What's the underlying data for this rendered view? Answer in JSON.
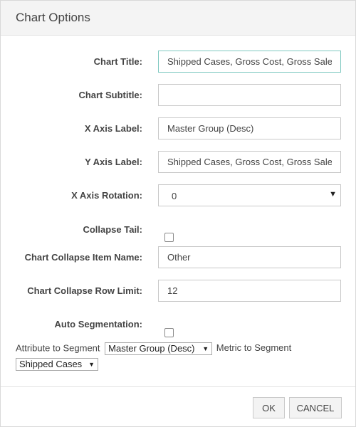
{
  "dialog": {
    "title": "Chart Options"
  },
  "fields": {
    "chart_title": {
      "label": "Chart Title:",
      "value": "Shipped Cases, Gross Cost, Gross Sales"
    },
    "chart_subtitle": {
      "label": "Chart Subtitle:",
      "value": ""
    },
    "x_axis_label": {
      "label": "X Axis Label:",
      "value": "Master Group (Desc)"
    },
    "y_axis_label": {
      "label": "Y Axis Label:",
      "value": "Shipped Cases, Gross Cost, Gross Sales"
    },
    "x_axis_rotation": {
      "label": "X Axis Rotation:",
      "value": "0"
    },
    "collapse_tail": {
      "label": "Collapse Tail:",
      "checked": false
    },
    "collapse_item_name": {
      "label": "Chart Collapse Item Name:",
      "value": "Other"
    },
    "collapse_row_limit": {
      "label": "Chart Collapse Row Limit:",
      "value": "12"
    },
    "auto_segmentation": {
      "label": "Auto Segmentation:",
      "checked": false
    }
  },
  "segmentation": {
    "attribute_label": "Attribute to Segment",
    "attribute_value": "Master Group (Desc)",
    "metric_label": "Metric to Segment",
    "metric_value": "Shipped Cases"
  },
  "footer": {
    "ok_label": "OK",
    "cancel_label": "CANCEL"
  },
  "icons": {
    "dropdown": "dropdown-arrow-icon",
    "checkbox": "checkbox-icon"
  }
}
